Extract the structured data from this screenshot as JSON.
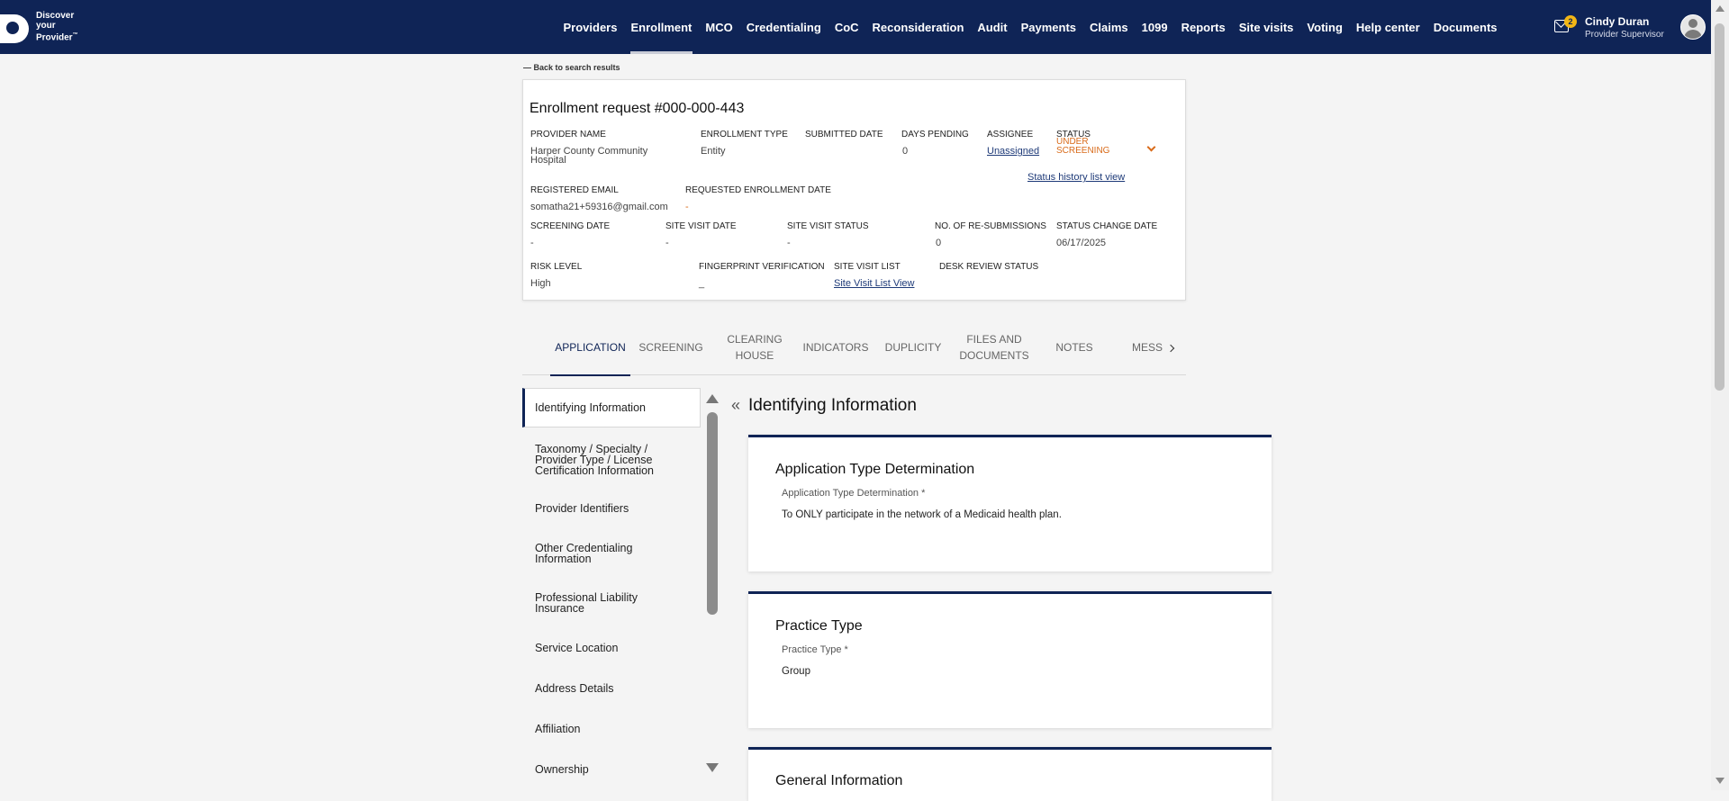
{
  "brand": {
    "line1": "Discover",
    "line2": "your",
    "line3": "Provider",
    "tm": "™"
  },
  "nav": {
    "items": [
      "Providers",
      "Enrollment",
      "MCO",
      "Credentialing",
      "CoC",
      "Reconsideration",
      "Audit",
      "Payments",
      "Claims",
      "1099",
      "Reports",
      "Site visits",
      "Voting",
      "Help center",
      "Documents"
    ],
    "active": "Enrollment",
    "mail_count": "2",
    "user_name": "Cindy Duran",
    "user_role": "Provider Supervisor"
  },
  "back_link": "— Back to search results",
  "request": {
    "title": "Enrollment request #000-000-443",
    "labels": {
      "provider_name": "PROVIDER NAME",
      "enrollment_type": "ENROLLMENT TYPE",
      "submitted_date": "SUBMITTED DATE",
      "days_pending": "DAYS PENDING",
      "assignee": "ASSIGNEE",
      "status": "STATUS",
      "registered_email": "REGISTERED EMAIL",
      "requested_enrollment_date": "REQUESTED ENROLLMENT DATE",
      "screening_date": "SCREENING DATE",
      "site_visit_date": "SITE VISIT DATE",
      "site_visit_status": "SITE VISIT STATUS",
      "resubmissions": "NO. OF RE-SUBMISSIONS",
      "status_change_date": "STATUS CHANGE DATE",
      "risk_level": "RISK LEVEL",
      "fingerprint": "FINGERPRINT VERIFICATION",
      "site_visit_list": "SITE VISIT LIST",
      "desk_review": "DESK REVIEW STATUS"
    },
    "values": {
      "provider_name_l1": "Harper County Community",
      "provider_name_l2": "Hospital",
      "enrollment_type": "Entity",
      "days_pending": "0",
      "assignee": "Unassigned",
      "status_l1": "UNDER",
      "status_l2": "SCREENING",
      "status_history": "Status history list view",
      "registered_email": "somatha21+59316@gmail.com",
      "requested_enrollment_date": "-",
      "screening_date": "-",
      "site_visit_date": "-",
      "site_visit_status": "-",
      "resubmissions": "0",
      "status_change_date": "06/17/2025",
      "risk_level": "High",
      "fingerprint": "_",
      "site_visit_list": "Site Visit List View"
    }
  },
  "tabs": {
    "application": "APPLICATION",
    "screening": "SCREENING",
    "clearing_l1": "CLEARING",
    "clearing_l2": "HOUSE",
    "indicators": "INDICATORS",
    "duplicity": "DUPLICITY",
    "files_l1": "FILES AND",
    "files_l2": "DOCUMENTS",
    "notes": "NOTES",
    "messages": "MESS"
  },
  "sidebar": {
    "identifying": "Identifying Information",
    "taxonomy_l1": "Taxonomy / Specialty /",
    "taxonomy_l2": "Provider Type / License",
    "taxonomy_l3": "Certification Information",
    "provider_identifiers": "Provider Identifiers",
    "other_cred_l1": "Other Credentialing",
    "other_cred_l2": "Information",
    "liability_l1": "Professional Liability",
    "liability_l2": "Insurance",
    "service_location": "Service Location",
    "address_details": "Address Details",
    "affiliation": "Affiliation",
    "ownership": "Ownership"
  },
  "main": {
    "collapse": "«",
    "title": "Identifying Information",
    "panel1": {
      "title": "Application Type Determination",
      "label": "Application Type Determination",
      "required": "*",
      "value": "To ONLY participate in the network of a Medicaid health plan."
    },
    "panel2": {
      "title": "Practice Type",
      "label": "Practice Type",
      "required": "*",
      "value": "Group"
    },
    "panel3": {
      "title": "General Information"
    }
  }
}
